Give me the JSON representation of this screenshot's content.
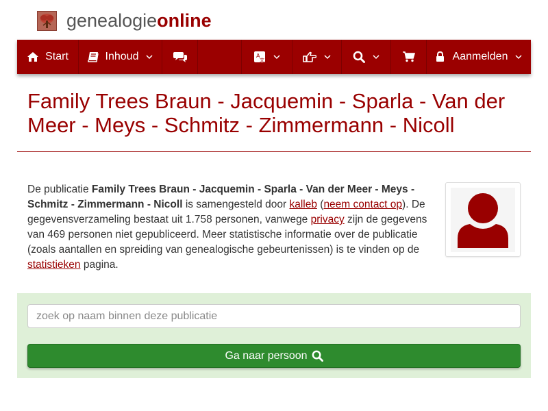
{
  "brand": {
    "part1": "genealogie",
    "part2": "online",
    "logo_icon": "tree-icon"
  },
  "nav": {
    "start": "Start",
    "inhoud": "Inhoud",
    "aanmelden": "Aanmelden",
    "icons": [
      "home-icon",
      "book-icon",
      "comments-icon",
      "language-icon",
      "hand-pointer-icon",
      "search-icon",
      "cart-icon",
      "lock-icon",
      "chevron-down-icon"
    ]
  },
  "page": {
    "title": "Family Trees Braun - Jacquemin - Sparla - Van der Meer - Meys - Schmitz - Zimmermann - Nicoll"
  },
  "intro": {
    "t1": "De publicatie ",
    "pub": "Family Trees Braun - Jacquemin - Sparla - Van der Meer - Meys - Schmitz - Zimmermann - Nicoll",
    "t2": " is samengesteld door ",
    "author": "kalleb",
    "t3": " (",
    "contact": "neem contact op",
    "t4": "). De gegevensverzameling bestaat uit 1.758 personen, vanwege ",
    "privacy": "privacy",
    "t5": " zijn de gegevens van 469 personen niet gepubliceerd. Meer statistische informatie over de publicatie (zoals aantallen en spreiding van genealogische gebeurtenissen) is te vinden op de ",
    "stats": "statistieken",
    "t6": " pagina."
  },
  "search": {
    "placeholder": "zoek op naam binnen deze publicatie",
    "button": "Ga naar persoon"
  },
  "colors": {
    "brand_red": "#990000",
    "nav_bg": "#9b0000",
    "panel_green": "#dff0d8",
    "button_green": "#2e8b2e"
  }
}
